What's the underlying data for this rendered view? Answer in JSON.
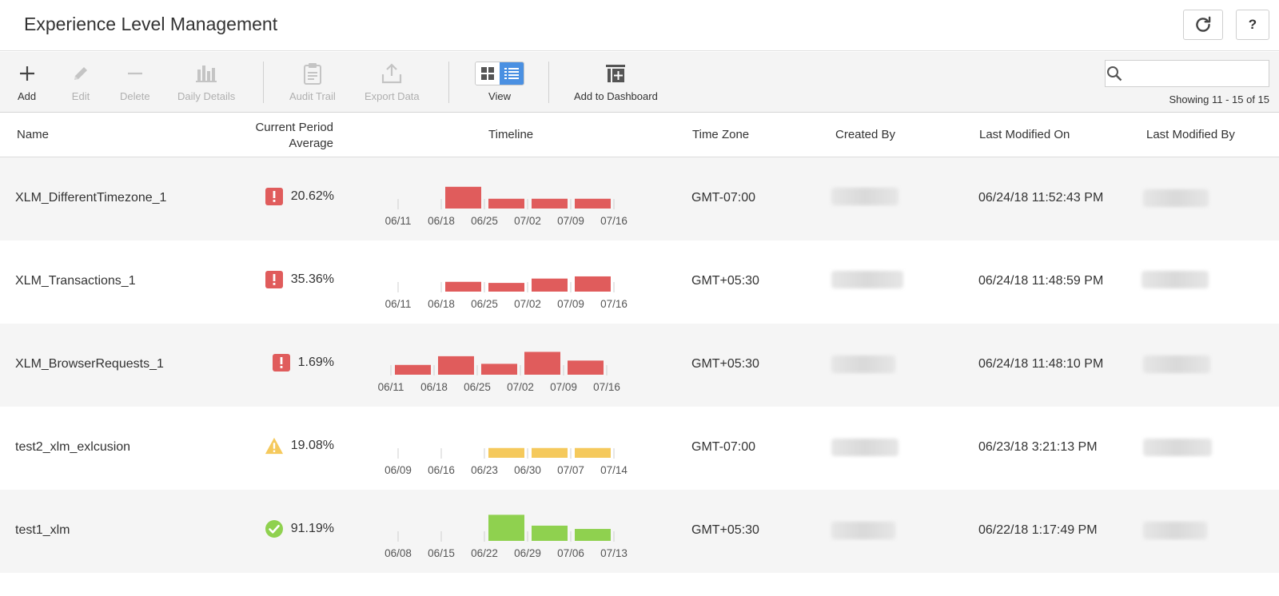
{
  "header": {
    "title": "Experience Level Management",
    "help_label": "?"
  },
  "toolbar": {
    "add": "Add",
    "edit": "Edit",
    "delete": "Delete",
    "daily_details": "Daily Details",
    "audit_trail": "Audit Trail",
    "export_data": "Export Data",
    "view": "View",
    "add_to_dashboard": "Add to Dashboard"
  },
  "search": {
    "placeholder": "",
    "value": ""
  },
  "showing": "Showing 11 - 15 of 15",
  "columns": {
    "name": "Name",
    "average_line1": "Current Period",
    "average_line2": "Average",
    "timeline": "Timeline",
    "time_zone": "Time Zone",
    "created_by": "Created By",
    "last_modified_on": "Last Modified On",
    "last_modified_by": "Last Modified By"
  },
  "colors": {
    "error": "#e05c5c",
    "warning": "#f5c95c",
    "ok": "#8fd14f",
    "accent": "#4a90e2"
  },
  "rows": [
    {
      "name": "XLM_DifferentTimezone_1",
      "status": "error",
      "status_icon": "exclamation-icon",
      "average": "20.62%",
      "time_zone": "GMT-07:00",
      "last_modified_on": "06/24/18 11:52:43 PM",
      "timeline": {
        "ticks": [
          "06/11",
          "06/18",
          "06/25",
          "07/02",
          "07/09",
          "07/16"
        ],
        "bars": [
          null,
          0.8,
          0.36,
          0.36,
          0.36
        ],
        "color": "#e05c5c"
      }
    },
    {
      "name": "XLM_Transactions_1",
      "status": "error",
      "status_icon": "exclamation-icon",
      "average": "35.36%",
      "time_zone": "GMT+05:30",
      "last_modified_on": "06/24/18 11:48:59 PM",
      "timeline": {
        "ticks": [
          "06/11",
          "06/18",
          "06/25",
          "07/02",
          "07/09",
          "07/16"
        ],
        "bars": [
          null,
          0.36,
          0.32,
          0.48,
          0.56
        ],
        "color": "#e05c5c"
      }
    },
    {
      "name": "XLM_BrowserRequests_1",
      "status": "error",
      "status_icon": "exclamation-icon",
      "average": "1.69%",
      "time_zone": "GMT+05:30",
      "last_modified_on": "06/24/18 11:48:10 PM",
      "timeline": {
        "ticks": [
          "06/11",
          "06/18",
          "06/25",
          "07/02",
          "07/09",
          "07/16"
        ],
        "bars": [
          0.36,
          0.68,
          0.4,
          0.84,
          0.52
        ],
        "color": "#e05c5c"
      }
    },
    {
      "name": "test2_xlm_exlcusion",
      "status": "warning",
      "status_icon": "warning-triangle-icon",
      "average": "19.08%",
      "time_zone": "GMT-07:00",
      "last_modified_on": "06/23/18 3:21:13 PM",
      "timeline": {
        "ticks": [
          "06/09",
          "06/16",
          "06/23",
          "06/30",
          "07/07",
          "07/14"
        ],
        "bars": [
          null,
          null,
          0.36,
          0.36,
          0.36
        ],
        "color": "#f5c95c"
      }
    },
    {
      "name": "test1_xlm",
      "status": "ok",
      "status_icon": "check-circle-icon",
      "average": "91.19%",
      "time_zone": "GMT+05:30",
      "last_modified_on": "06/22/18 1:17:49 PM",
      "timeline": {
        "ticks": [
          "06/08",
          "06/15",
          "06/22",
          "06/29",
          "07/06",
          "07/13"
        ],
        "bars": [
          null,
          null,
          0.96,
          0.56,
          0.44
        ],
        "color": "#8fd14f"
      }
    }
  ]
}
